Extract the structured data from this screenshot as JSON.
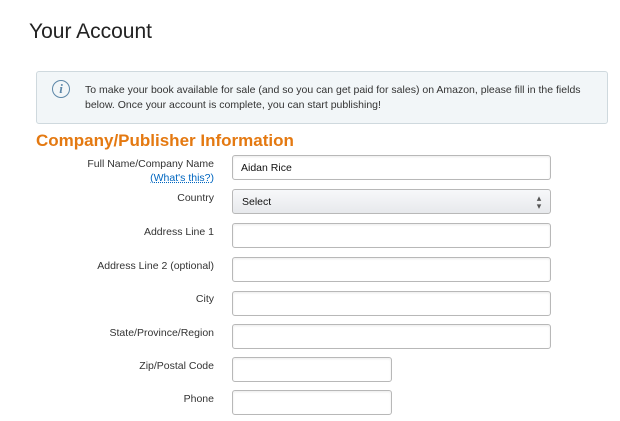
{
  "page": {
    "title": "Your Account"
  },
  "info_box": {
    "icon": "info-icon",
    "text": "To make your book available for sale (and so you can get paid for sales) on Amazon, please fill in the fields below. Once your account is complete, you can start publishing!"
  },
  "section": {
    "title": "Company/Publisher Information",
    "title_color": "#e47911"
  },
  "form": {
    "full_name": {
      "label": "Full Name/Company Name",
      "help_link": "(What's this?)",
      "value": "Aidan Rice"
    },
    "country": {
      "label": "Country",
      "selected": "Select"
    },
    "address1": {
      "label": "Address Line 1",
      "value": ""
    },
    "address2": {
      "label": "Address Line 2 (optional)",
      "value": ""
    },
    "city": {
      "label": "City",
      "value": ""
    },
    "state": {
      "label": "State/Province/Region",
      "value": ""
    },
    "zip": {
      "label": "Zip/Postal Code",
      "value": ""
    },
    "phone": {
      "label": "Phone",
      "value": ""
    }
  }
}
